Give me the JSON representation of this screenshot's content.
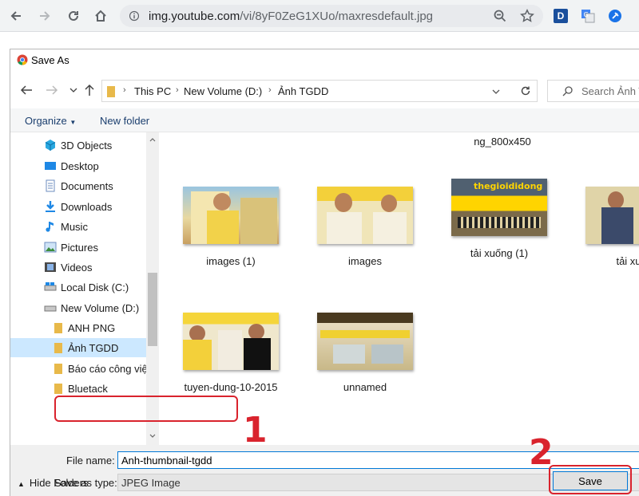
{
  "browser": {
    "url_host": "img.youtube.com",
    "url_path": "/vi/8yF0ZeG1XUo/maxresdefault.jpg",
    "extensions": [
      "D",
      "translate",
      "pin"
    ]
  },
  "dialog": {
    "title": "Save As",
    "breadcrumb": [
      "This PC",
      "New Volume (D:)",
      "Ảnh TGDD"
    ],
    "search_placeholder": "Search Ảnh T",
    "toolbar": {
      "organize": "Organize",
      "new_folder": "New folder"
    }
  },
  "sidebar": {
    "items": [
      {
        "label": "3D Objects",
        "icon": "3d-objects-icon"
      },
      {
        "label": "Desktop",
        "icon": "desktop-icon"
      },
      {
        "label": "Documents",
        "icon": "documents-icon"
      },
      {
        "label": "Downloads",
        "icon": "downloads-icon"
      },
      {
        "label": "Music",
        "icon": "music-icon"
      },
      {
        "label": "Pictures",
        "icon": "pictures-icon"
      },
      {
        "label": "Videos",
        "icon": "videos-icon"
      },
      {
        "label": "Local Disk (C:)",
        "icon": "drive-icon"
      },
      {
        "label": "New Volume (D:)",
        "icon": "drive-icon"
      },
      {
        "label": "ANH PNG",
        "icon": "folder-icon"
      },
      {
        "label": "Ảnh TGDD",
        "icon": "folder-icon",
        "selected": true
      },
      {
        "label": "Báo cáo công việ",
        "icon": "folder-icon"
      },
      {
        "label": "Bluetack",
        "icon": "folder-icon"
      }
    ]
  },
  "files": {
    "partial_top": "ng_800x450",
    "items": [
      {
        "name": "images (1)"
      },
      {
        "name": "images"
      },
      {
        "name": "tải xuống (1)"
      },
      {
        "name": "tải xu"
      },
      {
        "name": "tuyen-dung-10-2015"
      },
      {
        "name": "unnamed"
      }
    ]
  },
  "form": {
    "file_name_label": "File name:",
    "file_name_value": "Anh-thumbnail-tgdd",
    "save_type_label": "Save as type:",
    "save_type_value": "JPEG Image"
  },
  "footer": {
    "hide_folders": "Hide Folders",
    "save": "Save"
  },
  "annotations": {
    "step1": "1",
    "step2": "2"
  },
  "colors": {
    "accent": "#0078d7",
    "annotation_red": "#d9232d",
    "brand_yellow": "#ffd400"
  }
}
